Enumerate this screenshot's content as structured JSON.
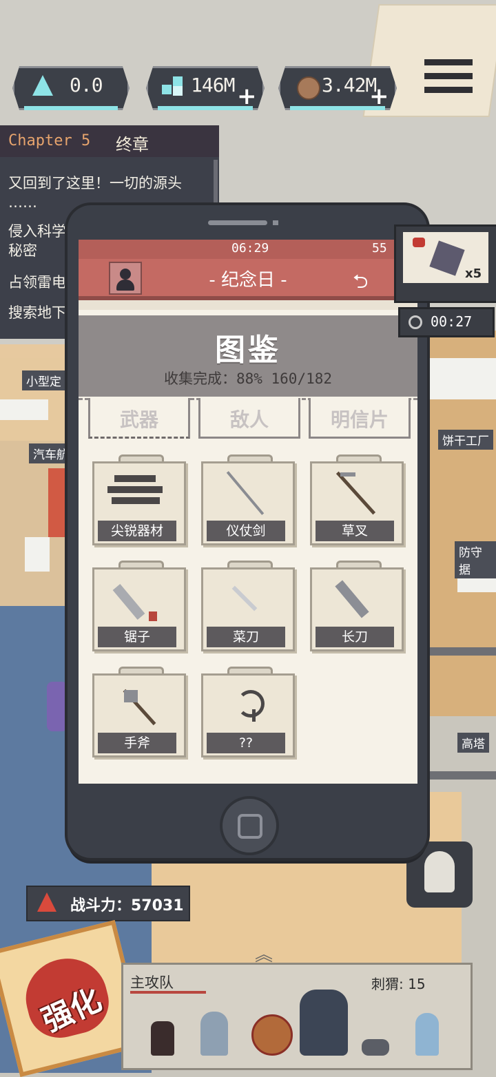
{
  "resources": [
    {
      "icon": "triangle-crystal-icon",
      "value": "0.0"
    },
    {
      "icon": "gem-cluster-icon",
      "value": "146M"
    },
    {
      "icon": "cookie-icon",
      "value": "3.42M"
    }
  ],
  "quest": {
    "chapter": "Chapter 5",
    "chapter_title": "终章",
    "items": [
      "又回到了这里！一切的源头",
      "……",
      "侵入科学",
      "秘密",
      "占领雷电",
      "搜索地下"
    ]
  },
  "phone": {
    "time": "06:29",
    "battery": "55",
    "app_title": "- 纪念日 -",
    "heading": "图鉴",
    "progress": "收集完成：88%  160/182",
    "tabs": [
      {
        "label": "武器"
      },
      {
        "label": "敌人"
      },
      {
        "label": "明信片"
      }
    ],
    "items": [
      {
        "label": "尖锐器材",
        "art": "tools-pile-icon"
      },
      {
        "label": "仪仗剑",
        "art": "sword-icon"
      },
      {
        "label": "草叉",
        "art": "pitchfork-icon"
      },
      {
        "label": "锯子",
        "art": "saw-icon"
      },
      {
        "label": "菜刀",
        "art": "kitchen-knife-icon"
      },
      {
        "label": "长刀",
        "art": "machete-icon"
      },
      {
        "label": "手斧",
        "art": "hatchet-icon"
      },
      {
        "label": "??",
        "art": "hook-icon"
      }
    ]
  },
  "badge": {
    "count": "x5",
    "timer": "00:27"
  },
  "map_labels": [
    "小型定",
    "汽车航",
    "饼干工厂",
    "防守据",
    "高塔"
  ],
  "power": {
    "label": "战斗力：57031"
  },
  "team": {
    "title": "主攻队",
    "orb": "刺猬: 15"
  },
  "boost": {
    "label": "强化"
  },
  "colors": {
    "accent": "#c46a63",
    "panel": "#3b3f48",
    "resource_bar": "#8ee3e6"
  }
}
